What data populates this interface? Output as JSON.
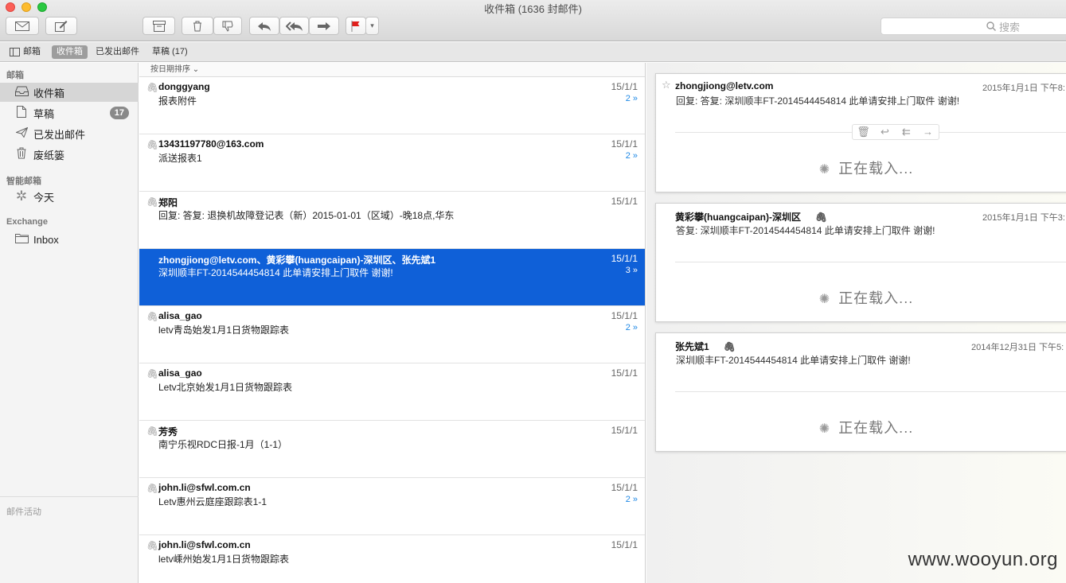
{
  "window": {
    "title": "收件箱 (1636 封邮件)"
  },
  "toolbar": {
    "search_placeholder": "搜索"
  },
  "favbar": {
    "items": [
      "邮箱",
      "收件箱",
      "已发出邮件",
      "草稿 (17)"
    ]
  },
  "sidebar": {
    "section_mailboxes": "邮箱",
    "inbox": "收件箱",
    "drafts": "草稿",
    "drafts_count": "17",
    "sent": "已发出邮件",
    "trash": "废纸篓",
    "section_smart": "智能邮箱",
    "today": "今天",
    "section_exchange": "Exchange",
    "exchange_inbox": "Inbox",
    "activity": "邮件活动"
  },
  "list": {
    "sort_label": "按日期排序",
    "messages": [
      {
        "from": "donggyang",
        "subject": "报表附件",
        "date": "15/1/1",
        "count": "2 »"
      },
      {
        "from": "13431197780@163.com",
        "subject": "派送报表1",
        "date": "15/1/1",
        "count": "2 »"
      },
      {
        "from": "郑阳",
        "subject": "回复: 答复: 退换机故障登记表（新）2015-01-01（区域）-晚18点,华东",
        "date": "15/1/1",
        "count": ""
      },
      {
        "from": "zhongjiong@letv.com、黄彩攀(huangcaipan)-深圳区、张先斌1",
        "subject": "深圳顺丰FT-2014544454814 此单请安排上门取件 谢谢!",
        "date": "15/1/1",
        "count": "3 »"
      },
      {
        "from": "alisa_gao",
        "subject": "letv青岛始发1月1日货物跟踪表",
        "date": "15/1/1",
        "count": "2 »"
      },
      {
        "from": "alisa_gao",
        "subject": "Letv北京始发1月1日货物跟踪表",
        "date": "15/1/1",
        "count": ""
      },
      {
        "from": "芳秀",
        "subject": "南宁乐视RDC日报-1月（1-1）",
        "date": "15/1/1",
        "count": ""
      },
      {
        "from": "john.li@sfwl.com.cn",
        "subject": "Letv惠州云庭座跟踪表1-1",
        "date": "15/1/1",
        "count": "2 »"
      },
      {
        "from": "john.li@sfwl.com.cn",
        "subject": "letv嵊州始发1月1日货物跟踪表",
        "date": "15/1/1",
        "count": ""
      }
    ]
  },
  "reader": {
    "loading_text": "正在载入...",
    "cards": [
      {
        "sender": "zhongjiong@letv.com",
        "date": "2015年1月1日 下午8:",
        "subject": "回复: 答复: 深圳顺丰FT-2014544454814 此单请安排上门取件 谢谢!"
      },
      {
        "sender": "黄彩攀(huangcaipan)-深圳区",
        "date": "2015年1月1日 下午3:",
        "subject": "答复: 深圳顺丰FT-2014544454814 此单请安排上门取件 谢谢!"
      },
      {
        "sender": "张先斌1",
        "date": "2014年12月31日 下午5:",
        "subject": "深圳顺丰FT-2014544454814 此单请安排上门取件 谢谢!"
      }
    ]
  },
  "watermark": "www.wooyun.org",
  "colors": {
    "selection": "#0f60d8",
    "thread_count": "#1e88e5",
    "flag": "#e0201c"
  }
}
